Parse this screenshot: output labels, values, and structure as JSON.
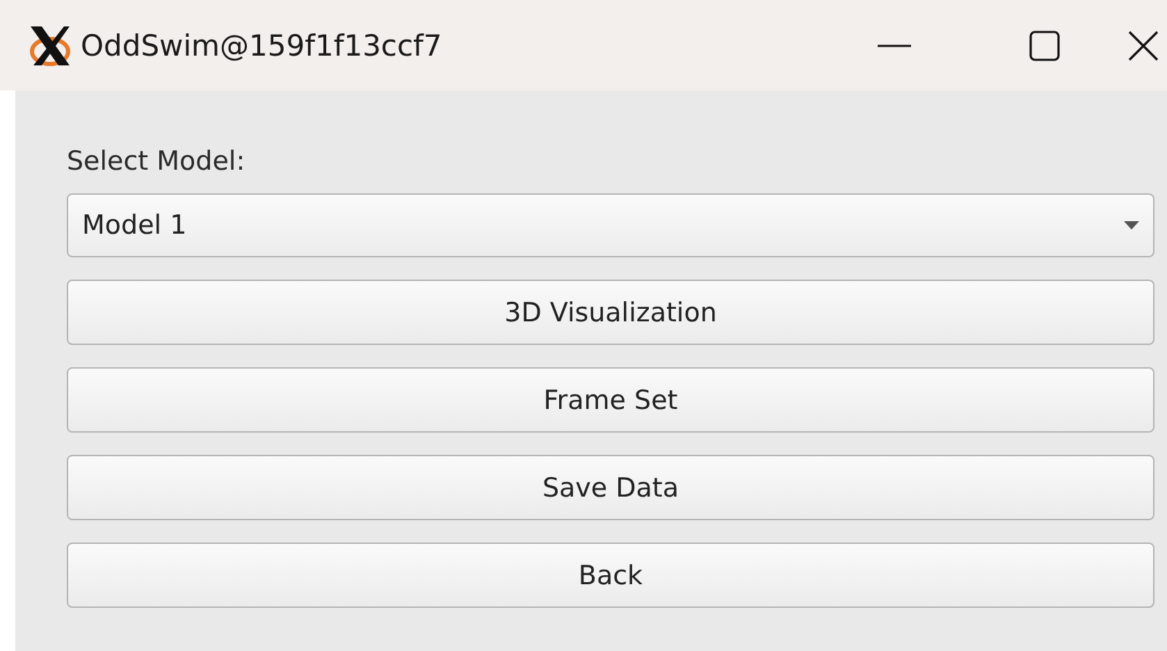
{
  "window": {
    "title": "OddSwim@159f1f13ccf7"
  },
  "model_select": {
    "label": "Select Model:",
    "value": "Model 1"
  },
  "buttons": [
    "3D Visualization",
    "Frame Set",
    "Save Data",
    "Back"
  ]
}
